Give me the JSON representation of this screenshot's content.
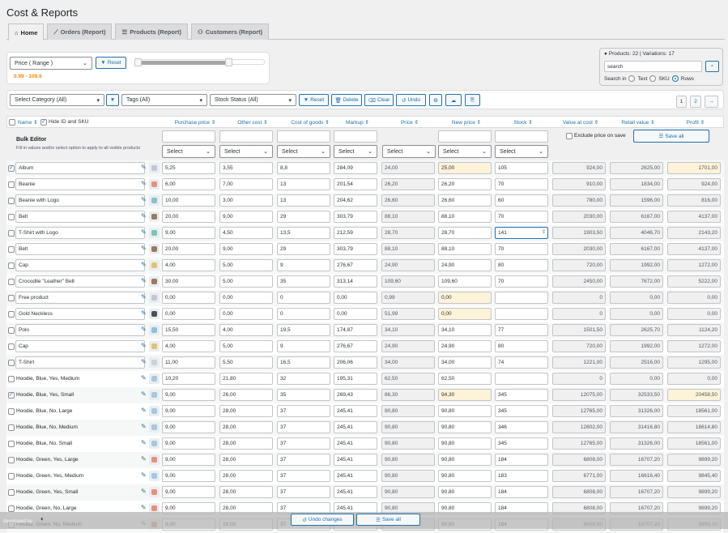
{
  "page": {
    "title": "Cost & Reports"
  },
  "tabs": [
    {
      "label": "Home",
      "icon": "home-icon",
      "active": true
    },
    {
      "label": "Orders (Report)",
      "icon": "chart-line-icon",
      "active": false
    },
    {
      "label": "Products (Report)",
      "icon": "list-icon",
      "active": false
    },
    {
      "label": "Customers (Report)",
      "icon": "users-icon",
      "active": false
    }
  ],
  "price_filter": {
    "select": "Price ( Range )",
    "reset": "Reset",
    "range_text": "0.99 - 109.6",
    "min": 0.99,
    "max": 109.6,
    "range_low_fraction": 0.0,
    "range_high_fraction": 0.72
  },
  "search": {
    "info": "Products: 22 | Variations: 17",
    "placeholder": "search",
    "value": "search",
    "search_in": "Search in",
    "options": [
      "Text",
      "SKU",
      "Rows"
    ],
    "selected": "Rows"
  },
  "filters": {
    "category": "Select Category (All)",
    "tags": "Tags (All)",
    "stock": "Stock Status (All)",
    "reset": "Reset",
    "delete": "Delete",
    "clear": "Clear",
    "undo": "Undo"
  },
  "pagination": {
    "pages": [
      "1",
      "2"
    ],
    "next": "→",
    "current": "1"
  },
  "columns": {
    "name": "Name",
    "hide_id": "Hide ID and SKU",
    "purchase": "Purchase price",
    "other": "Other cost",
    "cogs": "Cost of goods",
    "markup": "Markup",
    "price": "Price",
    "new_price": "New price",
    "stock": "Stock",
    "value_cost": "Value at cost",
    "retail": "Retail value",
    "profit": "Profit"
  },
  "bulk": {
    "title": "Bulk Editor",
    "hint": "Fill in values and/or select option to apply to all visible products",
    "select": "Select",
    "exclude": "Exclude price on save",
    "save_all": "Save all"
  },
  "rows": [
    {
      "name": "Album",
      "checked": true,
      "p": "5,25",
      "o": "3,55",
      "c": "8,8",
      "m": "284,09",
      "price": "24,00",
      "np": "25,00",
      "np_hl": true,
      "st": "105",
      "vc": "924,00",
      "rv": "2625,00",
      "pr": "1701,00",
      "pr_hl": true,
      "thumb": "#c8c4d8"
    },
    {
      "name": "Beanie",
      "checked": false,
      "p": "6,00",
      "o": "7,00",
      "c": "13",
      "m": "201,54",
      "price": "26,20",
      "np": "26,20",
      "st": "70",
      "vc": "910,00",
      "rv": "1834,00",
      "pr": "924,00",
      "thumb": "#e89080"
    },
    {
      "name": "Beanie with Logo",
      "checked": false,
      "p": "10,00",
      "o": "3,00",
      "c": "13",
      "m": "204,62",
      "price": "26,60",
      "np": "26,60",
      "st": "60",
      "vc": "780,00",
      "rv": "1596,00",
      "pr": "816,00",
      "thumb": "#8cc0c8"
    },
    {
      "name": "Belt",
      "checked": false,
      "p": "20,00",
      "o": "9,00",
      "c": "29",
      "m": "303,79",
      "price": "88,10",
      "np": "88,10",
      "st": "70",
      "vc": "2030,00",
      "rv": "6167,00",
      "pr": "4137,00",
      "thumb": "#a0785a"
    },
    {
      "name": "T-Shirt with Logo",
      "checked": false,
      "p": "9,00",
      "o": "4,50",
      "c": "13,5",
      "m": "212,59",
      "price": "28,70",
      "np": "28,70",
      "st": "141",
      "st_focus": true,
      "vc": "1903,50",
      "rv": "4046,70",
      "pr": "2143,20",
      "thumb": "#7cc4b4"
    },
    {
      "name": "Belt",
      "checked": false,
      "p": "20,00",
      "o": "9,00",
      "c": "29",
      "m": "303,79",
      "price": "88,10",
      "np": "88,10",
      "st": "70",
      "vc": "2030,00",
      "rv": "6167,00",
      "pr": "4137,00",
      "thumb": "#a0785a"
    },
    {
      "name": "Cap",
      "checked": false,
      "p": "4,00",
      "o": "5,00",
      "c": "9",
      "m": "276,67",
      "price": "24,90",
      "np": "24,90",
      "st": "80",
      "vc": "720,00",
      "rv": "1992,00",
      "pr": "1272,00",
      "thumb": "#e8c070"
    },
    {
      "name": "Crocodile \"Leather\" Belt",
      "checked": false,
      "p": "30,00",
      "o": "5,00",
      "c": "35",
      "m": "313,14",
      "price": "109,60",
      "np": "109,60",
      "st": "70",
      "vc": "2450,00",
      "rv": "7672,00",
      "pr": "5222,00",
      "thumb": "#a0785a"
    },
    {
      "name": "Free product",
      "checked": false,
      "p": "0,00",
      "o": "0,00",
      "c": "0",
      "m": "0,00",
      "price": "0,99",
      "np": "0,00",
      "np_hl": true,
      "st": "",
      "vc": "0",
      "rv": "0,00",
      "pr": "0,00",
      "thumb": "#c8c4d8"
    },
    {
      "name": "Gold Neckless",
      "checked": false,
      "p": "0,00",
      "o": "0,00",
      "c": "0",
      "m": "0,00",
      "price": "51,99",
      "np": "0,00",
      "np_hl": true,
      "st": "",
      "vc": "0",
      "rv": "0,00",
      "pr": "0,00",
      "thumb": "#505050"
    },
    {
      "name": "Polo",
      "checked": false,
      "p": "15,50",
      "o": "4,00",
      "c": "19,5",
      "m": "174,87",
      "price": "34,10",
      "np": "34,10",
      "st": "77",
      "vc": "1501,50",
      "rv": "2625,70",
      "pr": "1124,20",
      "thumb": "#8cc0dc"
    },
    {
      "name": "Cap",
      "checked": false,
      "p": "4,00",
      "o": "5,00",
      "c": "9",
      "m": "276,67",
      "price": "24,90",
      "np": "24,90",
      "st": "80",
      "vc": "720,00",
      "rv": "1992,00",
      "pr": "1272,00",
      "thumb": "#e8c070"
    },
    {
      "name": "T-Shirt",
      "checked": false,
      "p": "11,00",
      "o": "5,50",
      "c": "16,5",
      "m": "206,06",
      "price": "34,00",
      "np": "34,00",
      "st": "74",
      "vc": "1221,00",
      "rv": "2516,00",
      "pr": "1295,00",
      "thumb": "#d0d0d0"
    },
    {
      "name": "Hoodie, Blue, Yes, Medium",
      "checked": false,
      "var": true,
      "p": "10,20",
      "o": "21,80",
      "c": "32",
      "m": "195,31",
      "price": "62,50",
      "np": "62,50",
      "st": "",
      "vc": "0",
      "rv": "0,00",
      "pr": "0,00",
      "thumb": "#a8c8dc"
    },
    {
      "name": "Hoodie, Blue, Yes, Small",
      "checked": true,
      "var": true,
      "p": "9,00",
      "o": "26,00",
      "c": "35",
      "m": "269,43",
      "price": "86,30",
      "np": "94,30",
      "np_hl": true,
      "st": "345",
      "vc": "12075,00",
      "rv": "32533,50",
      "pr": "20458,50",
      "pr_hl": true,
      "thumb": "#a8c8dc"
    },
    {
      "name": "Hoodie, Blue, No, Large",
      "checked": false,
      "var": true,
      "p": "9,00",
      "o": "28,00",
      "c": "37",
      "m": "245,41",
      "price": "90,80",
      "np": "90,80",
      "st": "345",
      "vc": "12765,00",
      "rv": "31326,00",
      "pr": "18561,00",
      "thumb": "#a8c8dc"
    },
    {
      "name": "Hoodie, Blue, No, Medium",
      "checked": false,
      "var": true,
      "p": "9,00",
      "o": "28,00",
      "c": "37",
      "m": "245,41",
      "price": "90,80",
      "np": "90,80",
      "st": "346",
      "vc": "12802,00",
      "rv": "31416,80",
      "pr": "18614,80",
      "thumb": "#a8c8dc"
    },
    {
      "name": "Hoodie, Blue, No, Small",
      "checked": false,
      "var": true,
      "p": "9,00",
      "o": "28,00",
      "c": "37",
      "m": "245,41",
      "price": "90,80",
      "np": "90,80",
      "st": "345",
      "vc": "12765,00",
      "rv": "31326,00",
      "pr": "18561,00",
      "thumb": "#a8c8dc"
    },
    {
      "name": "Hoodie, Green, Yes, Large",
      "checked": false,
      "var": true,
      "p": "9,00",
      "o": "28,00",
      "c": "37",
      "m": "245,41",
      "price": "90,80",
      "np": "90,80",
      "st": "184",
      "vc": "6808,00",
      "rv": "16707,20",
      "pr": "9899,20",
      "thumb": "#e8907c"
    },
    {
      "name": "Hoodie, Green, Yes, Medium",
      "checked": false,
      "var": true,
      "p": "9,00",
      "o": "28,00",
      "c": "37",
      "m": "245,41",
      "price": "90,80",
      "np": "90,80",
      "st": "183",
      "vc": "6771,00",
      "rv": "16616,40",
      "pr": "9845,40",
      "thumb": "#a8c8dc"
    },
    {
      "name": "Hoodie, Green, Yes, Small",
      "checked": false,
      "var": true,
      "p": "9,00",
      "o": "28,00",
      "c": "37",
      "m": "245,41",
      "price": "90,80",
      "np": "90,80",
      "st": "184",
      "vc": "6808,00",
      "rv": "16707,20",
      "pr": "9899,20",
      "thumb": "#e8907c"
    },
    {
      "name": "Hoodie, Green, No, Large",
      "checked": false,
      "var": true,
      "p": "9,00",
      "o": "28,00",
      "c": "37",
      "m": "245,41",
      "price": "90,80",
      "np": "90,80",
      "st": "184",
      "vc": "6808,00",
      "rv": "16707,20",
      "pr": "9899,20",
      "thumb": "#e8907c"
    },
    {
      "name": "Hoodie, Green, No, Medium",
      "checked": false,
      "var": true,
      "p": "9,00",
      "o": "28,00",
      "c": "37",
      "m": "245,41",
      "price": "90,80",
      "np": "90,80",
      "st": "184",
      "vc": "6808,00",
      "rv": "16707,20",
      "pr": "9899,20",
      "thumb": "#e8907c"
    }
  ],
  "footer": {
    "developed_by": "developed by",
    "undo_changes": "Undo changes",
    "save_all": "Save all"
  },
  "colors": {
    "accent": "#2271b1",
    "highlight": "#fcf3d9",
    "range_text": "#f0880a"
  }
}
